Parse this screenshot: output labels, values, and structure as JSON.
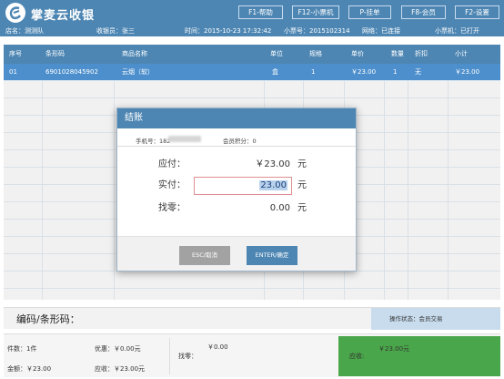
{
  "app": {
    "title": "掌麦云收银",
    "function_buttons": [
      "F1-帮助",
      "F12-小票机",
      "P-挂单",
      "F8-会员",
      "F2-设置"
    ]
  },
  "infobar": {
    "store": "店名：测测队",
    "cashier": "收银员：张三",
    "time": "时间：2015-10-23 17:32:42",
    "ticket_no": "小票号：2015102314",
    "network": "网络：已连接",
    "printer": "小票机：已打开"
  },
  "table": {
    "headers": [
      "序号",
      "条形码",
      "商品名称",
      "单位",
      "规格",
      "单价",
      "数量",
      "折扣",
      "小计"
    ],
    "rows": [
      [
        "01",
        "6901028045902",
        "云烟（软）",
        "盒",
        "1",
        "￥23.00",
        "1",
        "无",
        "￥23.00"
      ]
    ]
  },
  "dialog": {
    "title": "结账",
    "phone_label": "手机号：182",
    "points_label": "会员积分：0",
    "due_label": "应付：",
    "due_value": "￥23.00",
    "paid_label": "实付：",
    "paid_value": "23.00",
    "change_label": "找零：",
    "change_value": "0.00",
    "unit": "元",
    "esc_button": "ESC/取消",
    "enter_button": "ENTER/确定"
  },
  "barcode": {
    "label": "编码/条形码：",
    "value": "",
    "op_status": "操作状态：会员交易"
  },
  "summary": {
    "count": "件数：1件",
    "discount": "优惠：￥0.00元",
    "amount": "金额：￥23.00",
    "receivable": "应收：￥23.00元",
    "change_label": "找零：",
    "change_value": "￥0.00",
    "due_label": "应收:",
    "due_value": "￥23.00元"
  },
  "colors": {
    "primary": "#4d86b3",
    "selected_row": "#4d8fcc",
    "due_green": "#4aa64a"
  }
}
